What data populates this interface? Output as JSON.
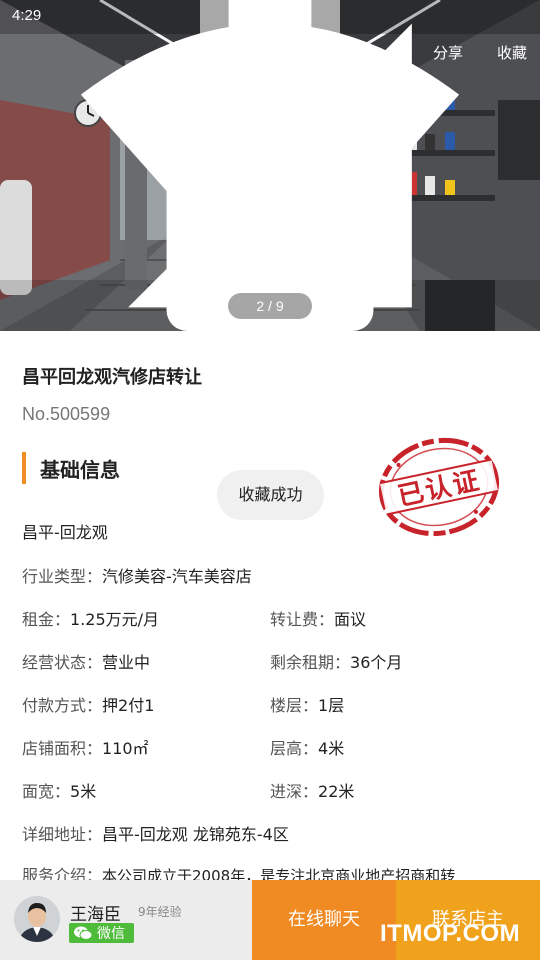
{
  "status_bar": {
    "time": "4:29"
  },
  "hero": {
    "share_label": "分享",
    "favorite_label": "收藏",
    "pager": "2 / 9"
  },
  "listing": {
    "title": "昌平回龙观汽修店转让",
    "number": "No.500599",
    "section_title": "基础信息",
    "location": "昌平-回龙观",
    "stamp_text": "已认证",
    "rows": {
      "industry_label": "行业类型：",
      "industry_value": "汽修美容-汽车美容店",
      "rent_label": "租金：",
      "rent_value": "1.25万元/月",
      "transfer_label": "转让费：",
      "transfer_value": "面议",
      "status_label": "经营状态：",
      "status_value": "营业中",
      "lease_label": "剩余租期：",
      "lease_value": "36个月",
      "payment_label": "付款方式：",
      "payment_value": "押2付1",
      "floor_label": "楼层：",
      "floor_value": "1层",
      "area_label": "店铺面积：",
      "area_value": "110㎡",
      "height_label": "层高：",
      "height_value": "4米",
      "width_label": "面宽：",
      "width_value": "5米",
      "depth_label": "进深：",
      "depth_value": "22米",
      "address_label": "详细地址：",
      "address_value": "昌平-回龙观 龙锦苑东-4区",
      "intro_label": "服务介绍：",
      "intro_value": "本公司成立于2008年，是专注北京商业地产招商和转"
    }
  },
  "toast": {
    "text": "收藏成功"
  },
  "agent": {
    "name": "王海臣",
    "experience": "9年经验",
    "wechat_label": "微信"
  },
  "actions": {
    "chat_label": "在线聊天",
    "contact_label": "联系店主"
  },
  "watermark": "ITMOP.COM",
  "colors": {
    "accent_orange": "#f08a22",
    "contact_orange": "#f0a21c",
    "stamp_red": "#c8232b",
    "wechat_green": "#4fbb3a"
  }
}
